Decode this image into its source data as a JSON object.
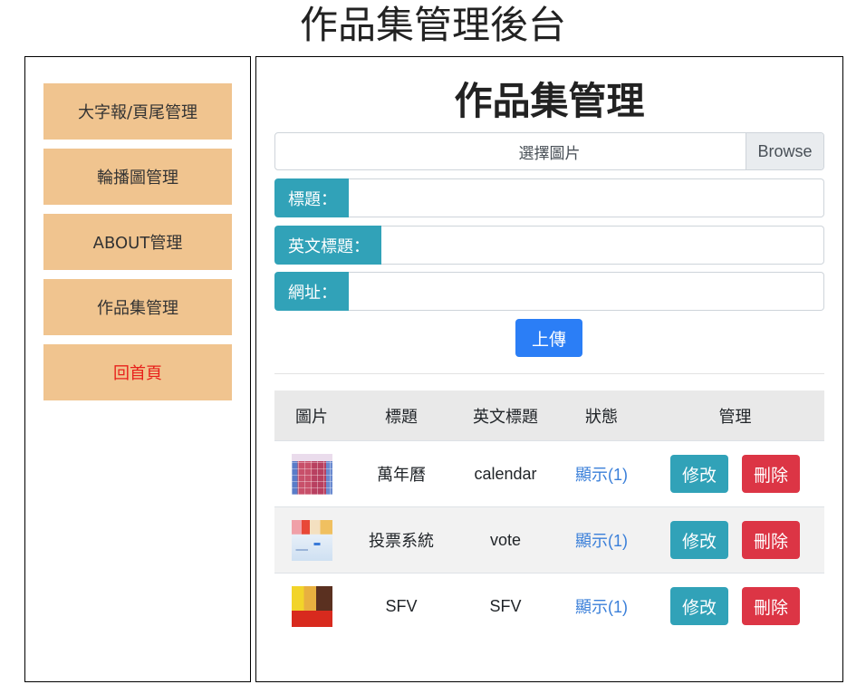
{
  "page_title": "作品集管理後台",
  "colors": {
    "menu_bg": "#f0c48f",
    "home_link": "#e8201b",
    "info": "#31a2b8",
    "primary": "#2b7ef6",
    "danger": "#dc3545",
    "link": "#3a7fd9"
  },
  "sidebar": {
    "items": [
      {
        "label": "大字報/頁尾管理"
      },
      {
        "label": "輪播圖管理"
      },
      {
        "label": "ABOUT管理"
      },
      {
        "label": "作品集管理"
      },
      {
        "label": "回首頁"
      }
    ]
  },
  "main": {
    "heading": "作品集管理",
    "file_input": {
      "label": "選擇圖片",
      "browse_label": "Browse"
    },
    "fields": [
      {
        "label": "標題：",
        "value": ""
      },
      {
        "label": "英文標題：",
        "value": ""
      },
      {
        "label": "網址：",
        "value": ""
      }
    ],
    "upload_label": "上傳",
    "table": {
      "headers": [
        "圖片",
        "標題",
        "英文標題",
        "狀態",
        "管理"
      ],
      "rows": [
        {
          "title": "萬年曆",
          "en_title": "calendar",
          "status": "顯示(1)",
          "edit_label": "修改",
          "delete_label": "刪除"
        },
        {
          "title": "投票系統",
          "en_title": "vote",
          "status": "顯示(1)",
          "edit_label": "修改",
          "delete_label": "刪除"
        },
        {
          "title": "SFV",
          "en_title": "SFV",
          "status": "顯示(1)",
          "edit_label": "修改",
          "delete_label": "刪除"
        }
      ]
    }
  }
}
